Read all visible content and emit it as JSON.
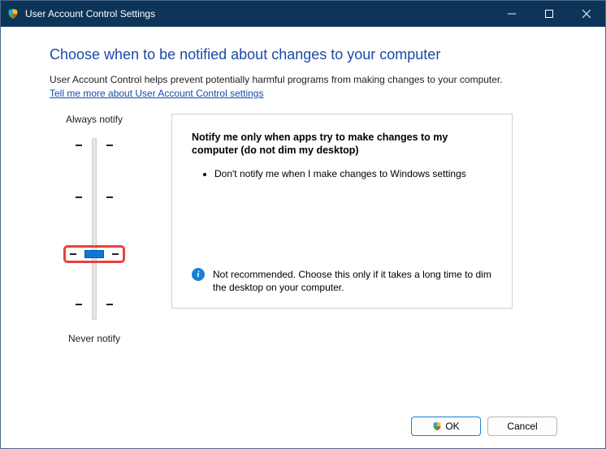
{
  "window": {
    "title": "User Account Control Settings"
  },
  "main": {
    "heading": "Choose when to be notified about changes to your computer",
    "intro": "User Account Control helps prevent potentially harmful programs from making changes to your computer.",
    "link": "Tell me more about User Account Control settings"
  },
  "slider": {
    "top_label": "Always notify",
    "bottom_label": "Never notify",
    "selected_level": 1,
    "levels": 4
  },
  "panel": {
    "title": "Notify me only when apps try to make changes to my computer (do not dim my desktop)",
    "bullets": [
      "Don't notify me when I make changes to Windows settings"
    ],
    "recommendation": "Not recommended. Choose this only if it takes a long time to dim the desktop on your computer."
  },
  "buttons": {
    "ok": "OK",
    "cancel": "Cancel"
  }
}
